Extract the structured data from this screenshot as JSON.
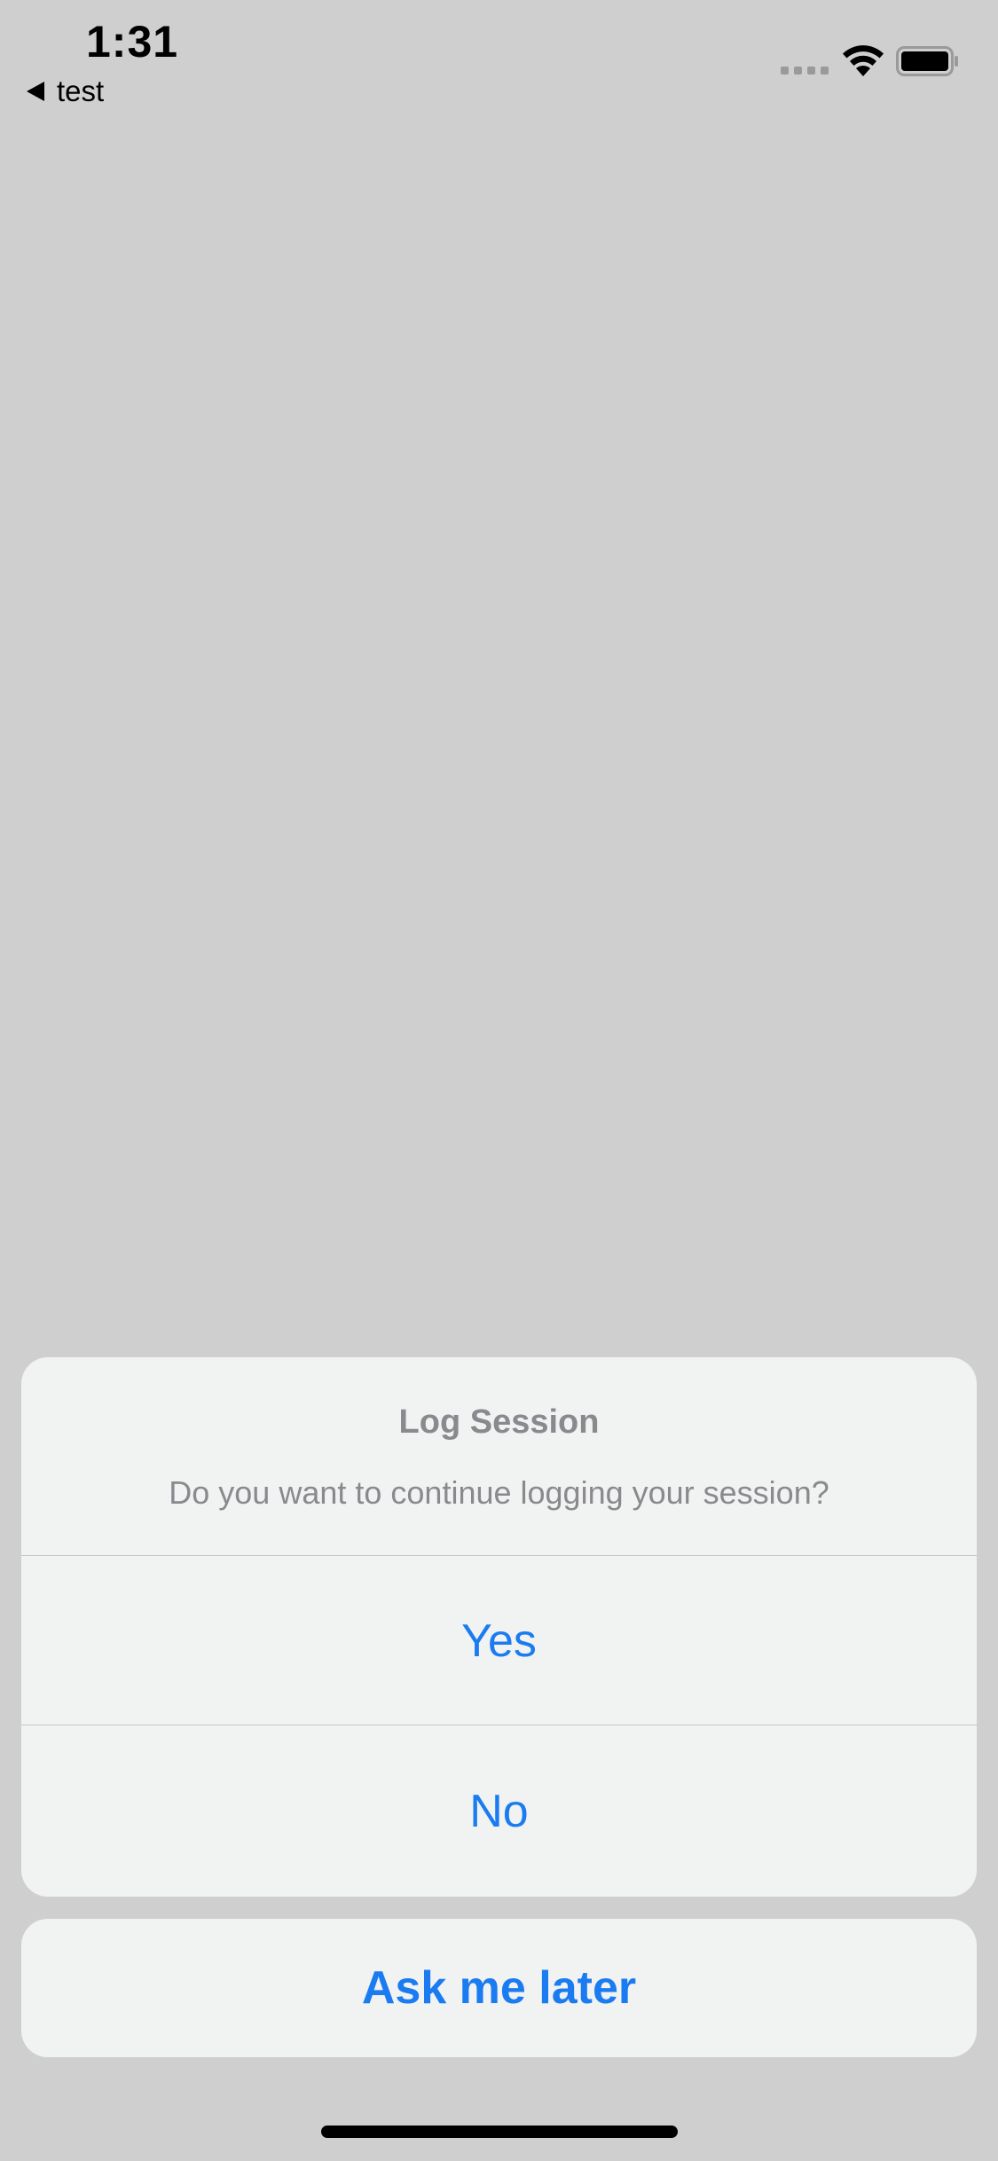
{
  "status_bar": {
    "time": "1:31",
    "back_label": "test"
  },
  "action_sheet": {
    "title": "Log Session",
    "message": "Do you want to continue logging your session?",
    "actions": [
      {
        "label": "Yes"
      },
      {
        "label": "No"
      }
    ],
    "cancel_label": "Ask me later"
  },
  "colors": {
    "background": "#cfcfcf",
    "sheet": "#f1f2f2",
    "accent": "#1a7cf0",
    "secondary_text": "#8a8a8e"
  },
  "icons": [
    "back-arrow-icon",
    "cellular-signal-icon",
    "wifi-icon",
    "battery-icon"
  ]
}
